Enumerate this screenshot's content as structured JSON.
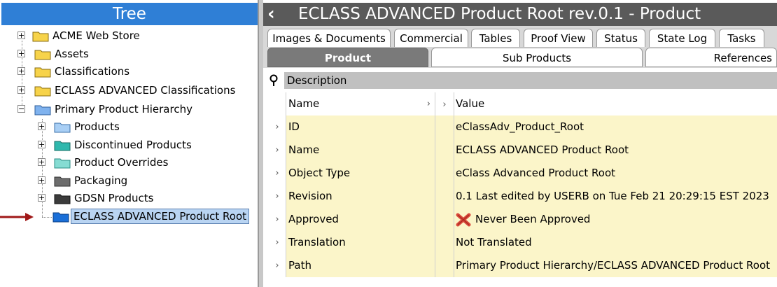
{
  "tree": {
    "header": "Tree",
    "items": [
      {
        "label": "ACME Web Store",
        "expander": "+"
      },
      {
        "label": "Assets",
        "expander": "+"
      },
      {
        "label": "Classifications",
        "expander": "+"
      },
      {
        "label": "ECLASS ADVANCED Classifications",
        "expander": "+"
      },
      {
        "label": "Primary Product Hierarchy",
        "expander": "−"
      },
      {
        "label": "Products",
        "expander": "+"
      },
      {
        "label": "Discontinued Products",
        "expander": "+"
      },
      {
        "label": "Product Overrides",
        "expander": "+"
      },
      {
        "label": "Packaging",
        "expander": "+"
      },
      {
        "label": "GDSN Products",
        "expander": "+"
      },
      {
        "label": "ECLASS ADVANCED Product Root",
        "expander": ""
      }
    ]
  },
  "header": {
    "back_icon": "‹",
    "title": "ECLASS ADVANCED Product Root rev.0.1 - Product"
  },
  "tabs": {
    "top": [
      "Images & Documents",
      "Commercial",
      "Tables",
      "Proof View",
      "Status",
      "State Log",
      "Tasks"
    ],
    "sub": [
      "Product",
      "Sub Products",
      "References"
    ]
  },
  "description": {
    "title": "Description",
    "header": {
      "name": "Name",
      "name_chev": "›",
      "mid_chev": "›",
      "value": "Value"
    },
    "rows": [
      {
        "chev": "›",
        "name": "ID",
        "value": "eClassAdv_Product_Root"
      },
      {
        "chev": "›",
        "name": "Name",
        "value": "ECLASS ADVANCED Product Root"
      },
      {
        "chev": "›",
        "name": "Object Type",
        "value": "eClass Advanced Product Root"
      },
      {
        "chev": "›",
        "name": "Revision",
        "value": "0.1 Last edited by USERB on Tue Feb 21 20:29:15 EST 2023"
      },
      {
        "chev": "›",
        "name": "Approved",
        "value": "Never Been Approved"
      },
      {
        "chev": "›",
        "name": "Translation",
        "value": "Not Translated"
      },
      {
        "chev": "›",
        "name": "Path",
        "value": "Primary Product Hierarchy/ECLASS ADVANCED Product Root"
      }
    ]
  },
  "colors": {
    "tree_header": "#2f7fd6",
    "title_bar": "#5a5a5a",
    "row_fill": "#fbf5c9",
    "arrow": "#a01818",
    "selected": "#b9d4f2"
  }
}
